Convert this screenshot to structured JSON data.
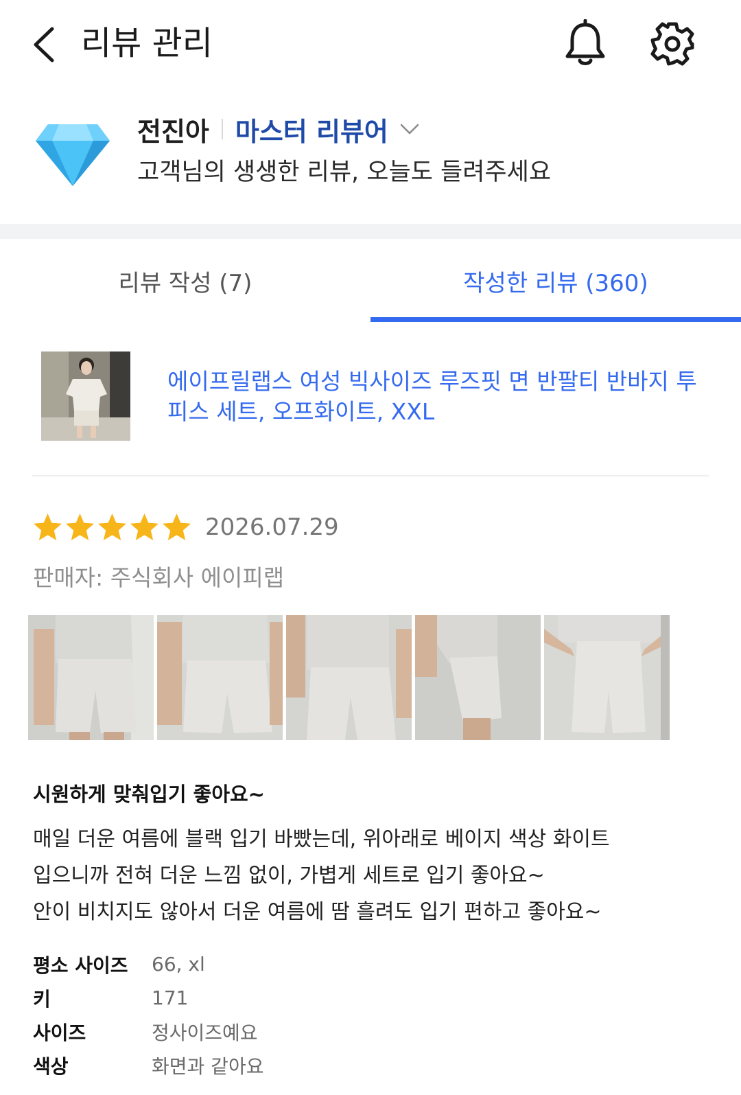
{
  "header": {
    "title": "리뷰 관리",
    "back_icon": "chevron-left-icon",
    "bell_icon": "bell-icon",
    "gear_icon": "gear-icon"
  },
  "profile": {
    "name": "전진아",
    "grade": "마스터 리뷰어",
    "badge_icon": "diamond-icon",
    "subtitle": "고객님의 생생한 리뷰, 오늘도 들려주세요"
  },
  "tabs": [
    {
      "label": "리뷰 작성 (7)",
      "active": false
    },
    {
      "label": "작성한 리뷰 (360)",
      "active": true
    }
  ],
  "review": {
    "product_title": "에이프릴랩스 여성 빅사이즈 루즈핏 면 반팔티 반바지 투피스 세트, 오프화이트, XXL",
    "rating": 5,
    "rating_max": 5,
    "date": "2026.07.29",
    "seller": "판매자: 주식회사 에이피랩",
    "photo_count": 5,
    "headline": "시원하게 맞춰입기 좋아요~",
    "body_lines": [
      "매일 더운 여름에 블랙 입기 바빴는데, 위아래로 베이지 색상 화이트",
      "입으니까 전혀 더운 느낌 없이, 가볍게 세트로 입기 좋아요~",
      "안이 비치지도 않아서 더운 여름에 땀 흘려도 입기 편하고 좋아요~"
    ],
    "survey": [
      {
        "label": "평소 사이즈",
        "value": "66, xl"
      },
      {
        "label": "키",
        "value": "171"
      },
      {
        "label": "사이즈",
        "value": "정사이즈예요"
      },
      {
        "label": "색상",
        "value": "화면과 같아요"
      }
    ]
  },
  "colors": {
    "accent": "#346aef",
    "grade": "#1f4aa8",
    "star": "#f8b51a",
    "band": "#f2f3f5"
  }
}
